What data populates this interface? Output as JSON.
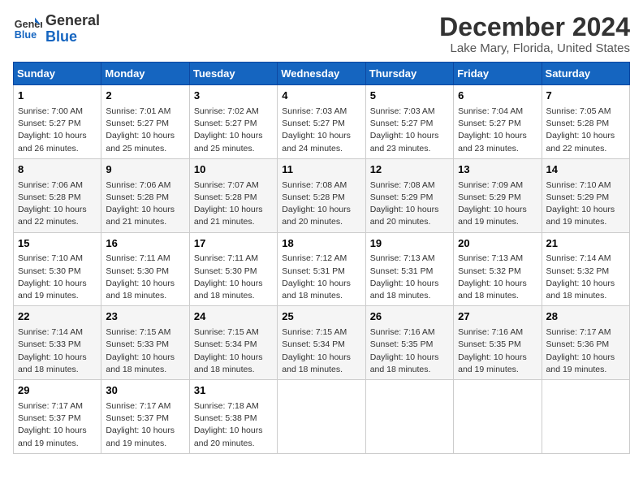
{
  "logo": {
    "line1": "General",
    "line2": "Blue"
  },
  "title": "December 2024",
  "subtitle": "Lake Mary, Florida, United States",
  "days_of_week": [
    "Sunday",
    "Monday",
    "Tuesday",
    "Wednesday",
    "Thursday",
    "Friday",
    "Saturday"
  ],
  "weeks": [
    [
      {
        "day": "1",
        "info": "Sunrise: 7:00 AM\nSunset: 5:27 PM\nDaylight: 10 hours\nand 26 minutes."
      },
      {
        "day": "2",
        "info": "Sunrise: 7:01 AM\nSunset: 5:27 PM\nDaylight: 10 hours\nand 25 minutes."
      },
      {
        "day": "3",
        "info": "Sunrise: 7:02 AM\nSunset: 5:27 PM\nDaylight: 10 hours\nand 25 minutes."
      },
      {
        "day": "4",
        "info": "Sunrise: 7:03 AM\nSunset: 5:27 PM\nDaylight: 10 hours\nand 24 minutes."
      },
      {
        "day": "5",
        "info": "Sunrise: 7:03 AM\nSunset: 5:27 PM\nDaylight: 10 hours\nand 23 minutes."
      },
      {
        "day": "6",
        "info": "Sunrise: 7:04 AM\nSunset: 5:27 PM\nDaylight: 10 hours\nand 23 minutes."
      },
      {
        "day": "7",
        "info": "Sunrise: 7:05 AM\nSunset: 5:28 PM\nDaylight: 10 hours\nand 22 minutes."
      }
    ],
    [
      {
        "day": "8",
        "info": "Sunrise: 7:06 AM\nSunset: 5:28 PM\nDaylight: 10 hours\nand 22 minutes."
      },
      {
        "day": "9",
        "info": "Sunrise: 7:06 AM\nSunset: 5:28 PM\nDaylight: 10 hours\nand 21 minutes."
      },
      {
        "day": "10",
        "info": "Sunrise: 7:07 AM\nSunset: 5:28 PM\nDaylight: 10 hours\nand 21 minutes."
      },
      {
        "day": "11",
        "info": "Sunrise: 7:08 AM\nSunset: 5:28 PM\nDaylight: 10 hours\nand 20 minutes."
      },
      {
        "day": "12",
        "info": "Sunrise: 7:08 AM\nSunset: 5:29 PM\nDaylight: 10 hours\nand 20 minutes."
      },
      {
        "day": "13",
        "info": "Sunrise: 7:09 AM\nSunset: 5:29 PM\nDaylight: 10 hours\nand 19 minutes."
      },
      {
        "day": "14",
        "info": "Sunrise: 7:10 AM\nSunset: 5:29 PM\nDaylight: 10 hours\nand 19 minutes."
      }
    ],
    [
      {
        "day": "15",
        "info": "Sunrise: 7:10 AM\nSunset: 5:30 PM\nDaylight: 10 hours\nand 19 minutes."
      },
      {
        "day": "16",
        "info": "Sunrise: 7:11 AM\nSunset: 5:30 PM\nDaylight: 10 hours\nand 18 minutes."
      },
      {
        "day": "17",
        "info": "Sunrise: 7:11 AM\nSunset: 5:30 PM\nDaylight: 10 hours\nand 18 minutes."
      },
      {
        "day": "18",
        "info": "Sunrise: 7:12 AM\nSunset: 5:31 PM\nDaylight: 10 hours\nand 18 minutes."
      },
      {
        "day": "19",
        "info": "Sunrise: 7:13 AM\nSunset: 5:31 PM\nDaylight: 10 hours\nand 18 minutes."
      },
      {
        "day": "20",
        "info": "Sunrise: 7:13 AM\nSunset: 5:32 PM\nDaylight: 10 hours\nand 18 minutes."
      },
      {
        "day": "21",
        "info": "Sunrise: 7:14 AM\nSunset: 5:32 PM\nDaylight: 10 hours\nand 18 minutes."
      }
    ],
    [
      {
        "day": "22",
        "info": "Sunrise: 7:14 AM\nSunset: 5:33 PM\nDaylight: 10 hours\nand 18 minutes."
      },
      {
        "day": "23",
        "info": "Sunrise: 7:15 AM\nSunset: 5:33 PM\nDaylight: 10 hours\nand 18 minutes."
      },
      {
        "day": "24",
        "info": "Sunrise: 7:15 AM\nSunset: 5:34 PM\nDaylight: 10 hours\nand 18 minutes."
      },
      {
        "day": "25",
        "info": "Sunrise: 7:15 AM\nSunset: 5:34 PM\nDaylight: 10 hours\nand 18 minutes."
      },
      {
        "day": "26",
        "info": "Sunrise: 7:16 AM\nSunset: 5:35 PM\nDaylight: 10 hours\nand 18 minutes."
      },
      {
        "day": "27",
        "info": "Sunrise: 7:16 AM\nSunset: 5:35 PM\nDaylight: 10 hours\nand 19 minutes."
      },
      {
        "day": "28",
        "info": "Sunrise: 7:17 AM\nSunset: 5:36 PM\nDaylight: 10 hours\nand 19 minutes."
      }
    ],
    [
      {
        "day": "29",
        "info": "Sunrise: 7:17 AM\nSunset: 5:37 PM\nDaylight: 10 hours\nand 19 minutes."
      },
      {
        "day": "30",
        "info": "Sunrise: 7:17 AM\nSunset: 5:37 PM\nDaylight: 10 hours\nand 19 minutes."
      },
      {
        "day": "31",
        "info": "Sunrise: 7:18 AM\nSunset: 5:38 PM\nDaylight: 10 hours\nand 20 minutes."
      },
      {
        "day": "",
        "info": ""
      },
      {
        "day": "",
        "info": ""
      },
      {
        "day": "",
        "info": ""
      },
      {
        "day": "",
        "info": ""
      }
    ]
  ]
}
